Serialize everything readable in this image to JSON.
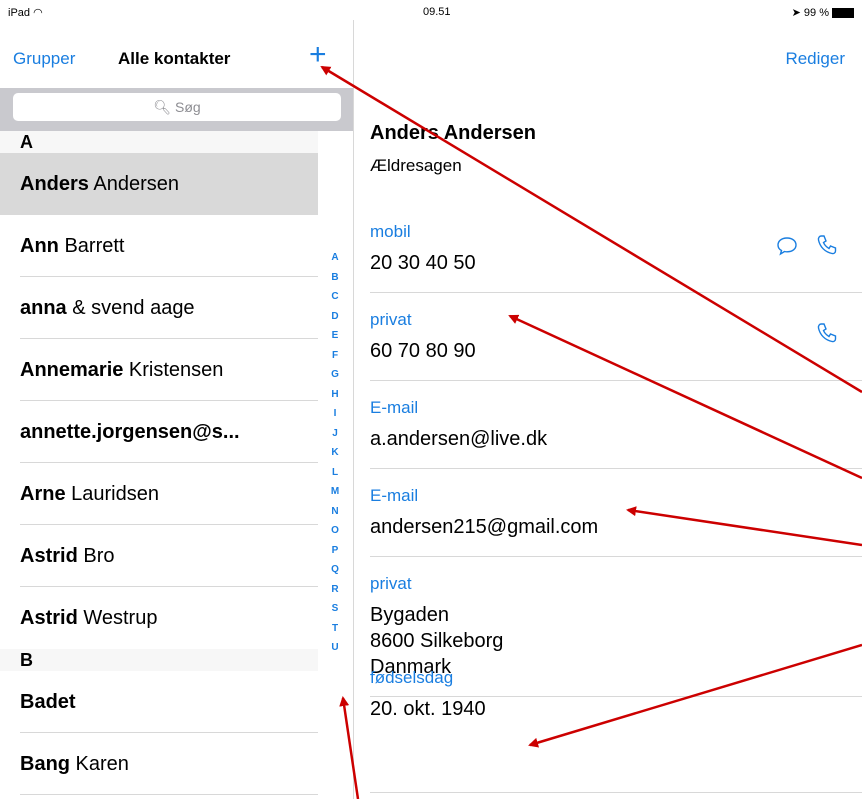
{
  "status_bar": {
    "device": "iPad",
    "time": "09.51",
    "battery": "99 %"
  },
  "left_nav": {
    "groups_label": "Grupper",
    "title": "Alle kontakter",
    "add_label": "+"
  },
  "search": {
    "placeholder": "Søg"
  },
  "sections": [
    {
      "header": "A",
      "rows": [
        {
          "bold": "Anders",
          "rest": " Andersen",
          "selected": true
        },
        {
          "bold": "Ann",
          "rest": " Barrett"
        },
        {
          "bold": "anna",
          "rest": " & svend aage"
        },
        {
          "bold": "Annemarie",
          "rest": " Kristensen"
        },
        {
          "bold": "annette.jorgensen@s...",
          "rest": ""
        },
        {
          "bold": "Arne",
          "rest": " Lauridsen"
        },
        {
          "bold": "Astrid",
          "rest": " Bro"
        },
        {
          "bold": "Astrid",
          "rest": " Westrup"
        }
      ]
    },
    {
      "header": "B",
      "rows": [
        {
          "bold": "Badet",
          "rest": ""
        },
        {
          "bold": "Bang",
          "rest": " Karen"
        }
      ]
    }
  ],
  "index_letters": [
    "A",
    "B",
    "C",
    "D",
    "E",
    "F",
    "G",
    "H",
    "I",
    "J",
    "K",
    "L",
    "M",
    "N",
    "O",
    "P",
    "Q",
    "R",
    "S",
    "T",
    "U"
  ],
  "right_nav": {
    "edit_label": "Rediger"
  },
  "contact": {
    "name": "Anders Andersen",
    "company": "Ældresagen",
    "mobile": {
      "label": "mobil",
      "value": "20 30 40 50"
    },
    "home_phone": {
      "label": "privat",
      "value": "60 70 80 90"
    },
    "email1": {
      "label": "E-mail",
      "value": "a.andersen@live.dk"
    },
    "email2": {
      "label": "E-mail",
      "value": "andersen215@gmail.com"
    },
    "address": {
      "label": "privat",
      "line1": "Bygaden",
      "line2": "8600 Silkeborg",
      "line3": "Danmark"
    },
    "birthday": {
      "label": "fødselsdag",
      "value": "20. okt. 1940"
    }
  },
  "colors": {
    "accent": "#1a7ee0",
    "annotation": "#cc0000"
  }
}
